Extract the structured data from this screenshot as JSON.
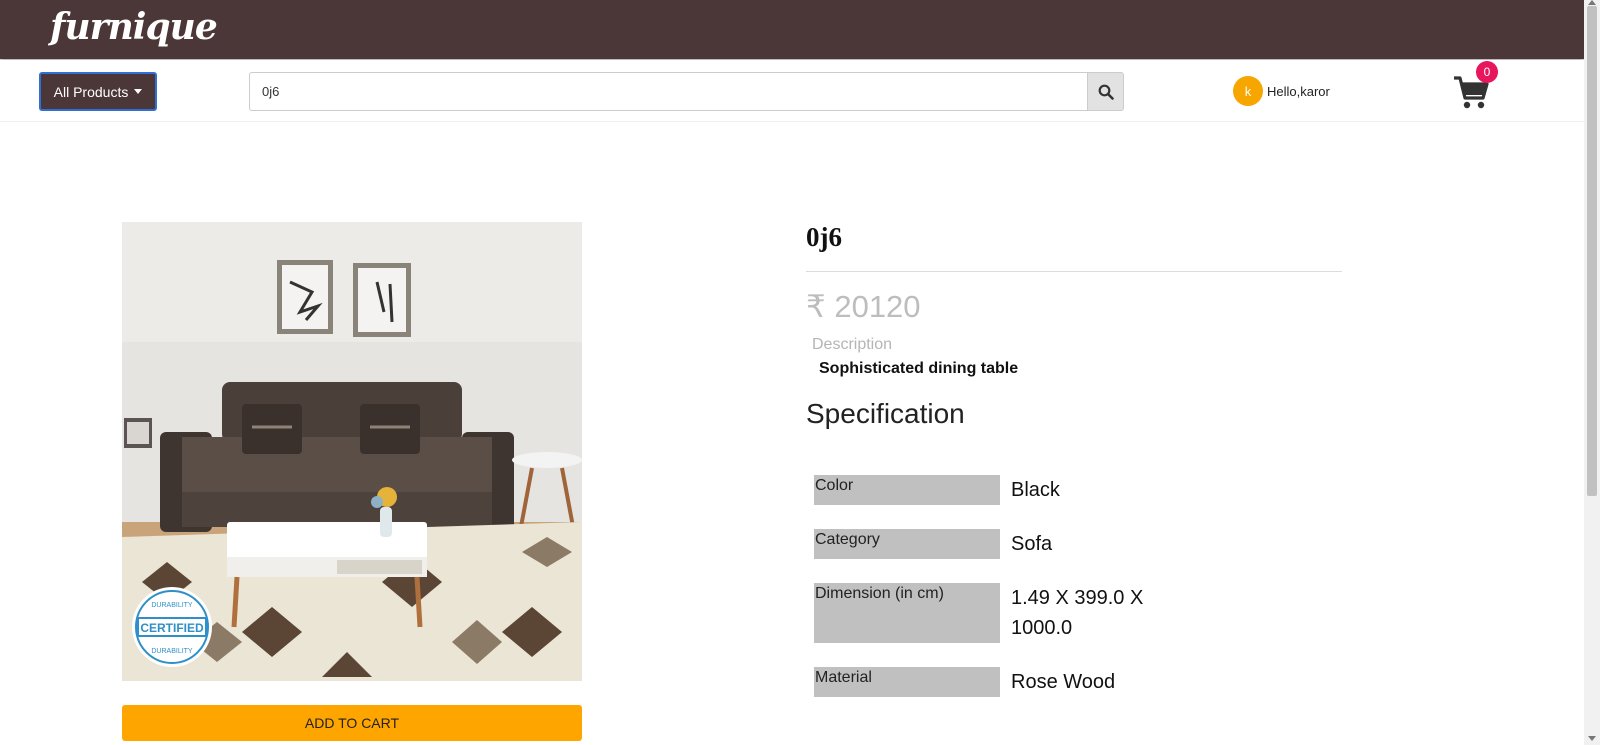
{
  "brand": {
    "logo_text": "furnique",
    "header_color": "#4b3737"
  },
  "nav": {
    "all_products_label": "All Products",
    "search_value": "0j6",
    "search_icon": "search-icon",
    "avatar_initial": "k",
    "greeting": "Hello,karor",
    "cart_icon": "cart-icon",
    "cart_count": "0"
  },
  "product": {
    "title": "0j6",
    "price": "₹ 20120",
    "description_label": "Description",
    "description": "Sophisticated dining table",
    "specification_heading": "Specification",
    "specs": [
      {
        "key": "Color",
        "value": "Black"
      },
      {
        "key": "Category",
        "value": "Sofa"
      },
      {
        "key": "Dimension (in cm)",
        "value": "1.49 X 399.0 X 1000.0"
      },
      {
        "key": "Material",
        "value": "Rose Wood"
      }
    ],
    "badge_text": "CERTIFIED",
    "badge_ring_text": "DURABILITY",
    "add_to_cart_label": "ADD TO CART",
    "accent_color": "#ffa500"
  }
}
